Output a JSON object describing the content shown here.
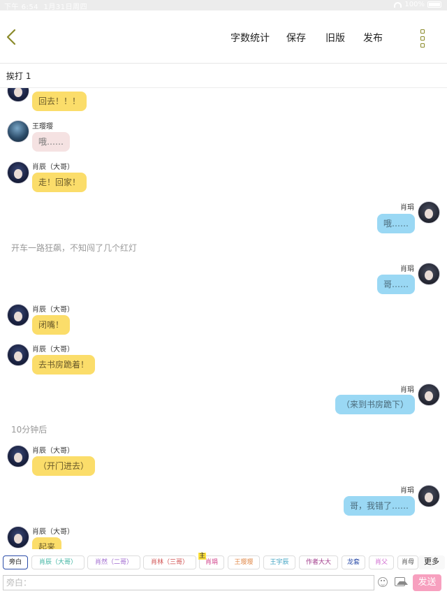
{
  "statusbar": {
    "time": "下午 6:54",
    "date": "1月31日周四",
    "battery": "100%"
  },
  "navbar": {
    "word_count": "字数统计",
    "save": "保存",
    "old_version": "旧版",
    "publish": "发布"
  },
  "scene": {
    "title": "挨打 1"
  },
  "messages": [
    {
      "type": "left",
      "name": "",
      "text": "回去！！！",
      "color": "yellow"
    },
    {
      "type": "left",
      "name": "王璎璎",
      "text": "哦……",
      "color": "pink"
    },
    {
      "type": "left",
      "name": "肖辰（大哥）",
      "text": "走！回家！",
      "color": "yellow"
    },
    {
      "type": "right",
      "name": "肖琄",
      "text": "哦……",
      "color": "blue"
    },
    {
      "type": "narration",
      "text": "开车一路狂飙，不知闯了几个红灯"
    },
    {
      "type": "right",
      "name": "肖琄",
      "text": "哥……",
      "color": "blue"
    },
    {
      "type": "left",
      "name": "肖辰（大哥）",
      "text": "闭嘴！",
      "color": "yellow"
    },
    {
      "type": "left",
      "name": "肖辰（大哥）",
      "text": "去书房跪着！",
      "color": "yellow"
    },
    {
      "type": "right",
      "name": "肖琄",
      "text": "（来到书房跪下）",
      "color": "blue"
    },
    {
      "type": "narration",
      "text": "10分钟后"
    },
    {
      "type": "left",
      "name": "肖辰（大哥）",
      "text": "（开门进去）",
      "color": "yellow"
    },
    {
      "type": "right",
      "name": "肖琄",
      "text": "哥，我错了……",
      "color": "blue"
    },
    {
      "type": "left",
      "name": "肖辰（大哥）",
      "text": "起来",
      "color": "yellow"
    }
  ],
  "roles": [
    {
      "label": "旁白",
      "color": "#222222"
    },
    {
      "label": "肖辰（大哥）",
      "color": "#3bb3a0"
    },
    {
      "label": "肖然（二哥）",
      "color": "#a06ad0"
    },
    {
      "label": "肖林（三哥）",
      "color": "#d05050"
    },
    {
      "label": "肖琄",
      "color": "#d0408a",
      "badge": "主"
    },
    {
      "label": "王璎璎",
      "color": "#e0894a"
    },
    {
      "label": "王宇辰",
      "color": "#3aa0c0"
    },
    {
      "label": "作者大大",
      "color": "#a03a8a"
    },
    {
      "label": "龙套",
      "color": "#2b4ca8"
    },
    {
      "label": "肖父",
      "color": "#d06ad0"
    },
    {
      "label": "肖母",
      "color": "#555555"
    }
  ],
  "more_label": "更多",
  "input": {
    "placeholder": "旁白："
  },
  "send_label": "发送"
}
